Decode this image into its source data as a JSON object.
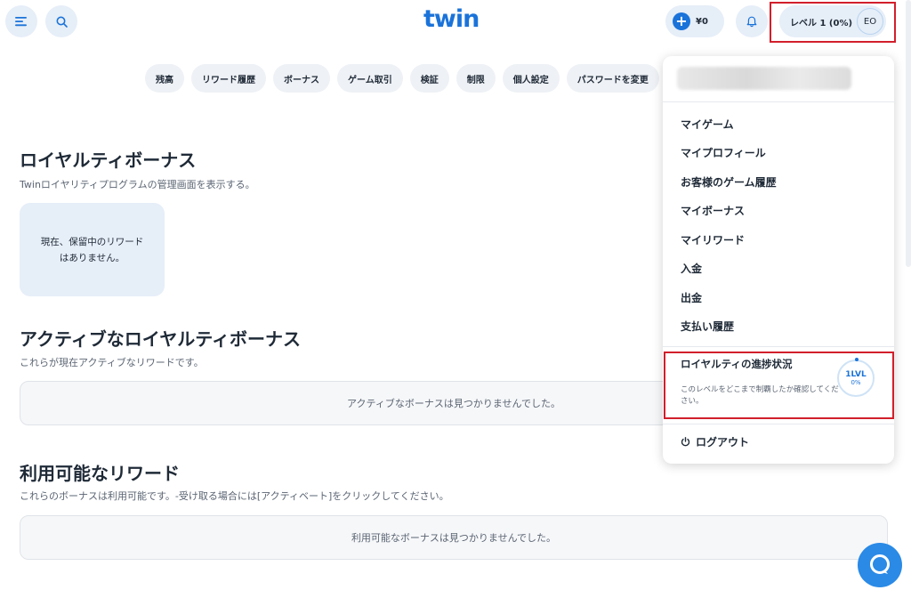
{
  "header": {
    "logo": "twin",
    "balance": "¥0",
    "level": "レベル 1 (0%)",
    "avatar_initials": "EO",
    "accent_color": "#1a73d9",
    "highlight_color": "#d21f2b"
  },
  "tabs": [
    "残高",
    "リワード履歴",
    "ボーナス",
    "ゲーム取引",
    "検証",
    "制限",
    "個人設定",
    "パスワードを変更"
  ],
  "main": {
    "section1_title": "ロイヤルティボーナス",
    "section1_desc": "Twinロイヤリティプログラムの管理画面を表示する。",
    "pending_reward": "現在、保留中のリワードはありません。",
    "section2_title": "アクティブなロイヤルティボーナス",
    "section2_desc": "これらが現在アクティブなリワードです。",
    "active_empty": "アクティブなボーナスは見つかりませんでした。",
    "section3_title": "利用可能なリワード",
    "section3_desc": "これらのボーナスは利用可能です。-受け取る場合には[アクティベート]をクリックしてください。",
    "available_empty": "利用可能なボーナスは見つかりませんでした。"
  },
  "dropdown": {
    "items": [
      "マイゲーム",
      "マイプロフィール",
      "お客様のゲーム履歴",
      "マイボーナス",
      "マイリワード",
      "入金",
      "出金",
      "支払い履歴"
    ],
    "loyalty_title": "ロイヤルティの進捗状況",
    "loyalty_desc": "このレベルをどこまで制覇したか確認してください。",
    "level_badge": "1LVL",
    "level_percent": "0%",
    "logout": "ログアウト"
  }
}
